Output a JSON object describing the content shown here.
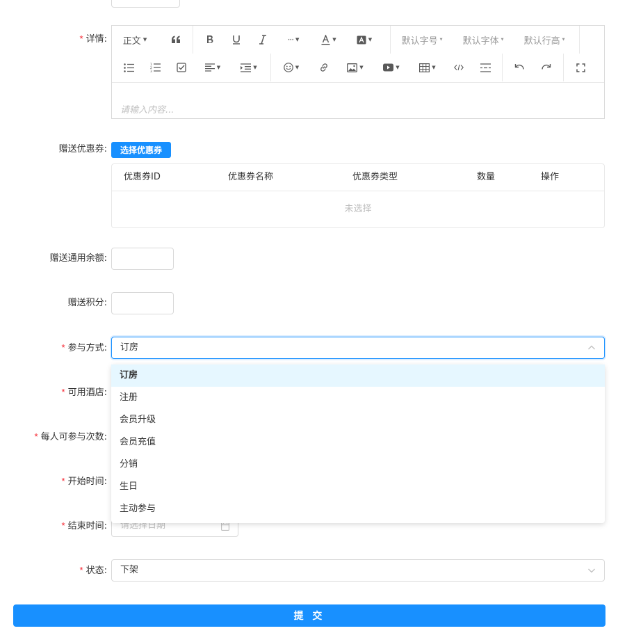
{
  "form": {
    "details": {
      "required": true,
      "label": "详情:"
    },
    "coupon": {
      "label": "赠送优惠券:",
      "button": "选择优惠券"
    },
    "balance": {
      "label": "赠送通用余额:",
      "value": ""
    },
    "points": {
      "label": "赠送积分:",
      "value": ""
    },
    "participation": {
      "required": true,
      "label": "参与方式:",
      "value": "订房",
      "options": [
        "订房",
        "注册",
        "会员升级",
        "会员充值",
        "分销",
        "生日",
        "主动参与"
      ]
    },
    "hotels": {
      "required": true,
      "label": "可用酒店:"
    },
    "times": {
      "required": true,
      "label": "每人可参与次数:"
    },
    "start": {
      "required": true,
      "label": "开始时间:"
    },
    "end": {
      "required": true,
      "label": "结束时间:",
      "placeholder": "请选择日期"
    },
    "status": {
      "required": true,
      "label": "状态:",
      "value": "下架"
    },
    "submit": "提 交"
  },
  "editor": {
    "heading": "正文",
    "font_size": "默认字号",
    "font_family": "默认字体",
    "line_height": "默认行高",
    "more": "···",
    "placeholder": "请输入内容..."
  },
  "coupon_table": {
    "headers": [
      "优惠券ID",
      "优惠券名称",
      "优惠券类型",
      "数量",
      "操作"
    ],
    "empty": "未选择"
  },
  "icons": {
    "editor_row1": [
      "chevron-down-icon",
      "quote-icon",
      "bold-icon",
      "underline-icon",
      "italic-icon",
      "more-icon",
      "font-color-icon",
      "bg-color-icon"
    ],
    "editor_row2": [
      "bullet-list-icon",
      "numbered-list-icon",
      "todo-icon",
      "align-icon",
      "indent-icon",
      "emoji-icon",
      "link-icon",
      "image-icon",
      "video-icon",
      "table-icon",
      "code-icon",
      "divider-icon",
      "undo-icon",
      "redo-icon",
      "fullscreen-icon"
    ],
    "select_arrow": "chevron-up-icon",
    "calendar": "calendar-icon"
  },
  "colors": {
    "primary": "#1890ff",
    "required": "#f5222d",
    "border": "#d9d9d9",
    "dropdown_active_bg": "#e6f7ff"
  }
}
